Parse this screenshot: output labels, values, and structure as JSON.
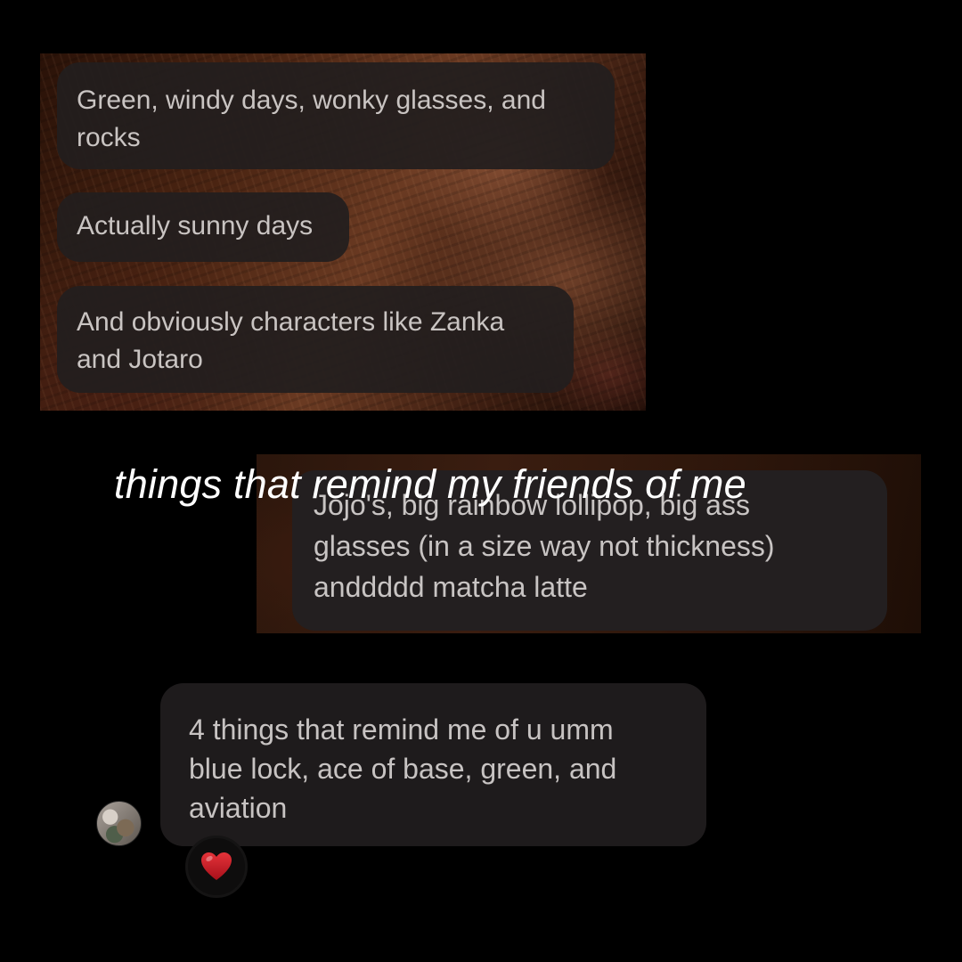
{
  "screenshot_top": {
    "messages": [
      {
        "text": "Green, windy days, wonky glasses, and\nrocks"
      },
      {
        "text": "Actually sunny days"
      },
      {
        "text": "And obviously characters like Zanka\nand Jotaro"
      }
    ]
  },
  "screenshot_middle": {
    "message_line1": "Jojo's, big rainbow lollipop, big ass",
    "message_line2": "glasses (in a size way not thickness)",
    "message_line3": "anddddd matcha latte"
  },
  "overlay": {
    "caption": "things that remind my friends of me"
  },
  "chat_bottom": {
    "message": "4 things that remind me of u umm\nblue lock, ace of base, green, and\naviation",
    "reaction": "❤️",
    "avatar_icon": "profile-picture"
  },
  "colors": {
    "background": "#000000",
    "bubble": "#231f20",
    "text": "#c8c4c3",
    "caption": "#ffffff",
    "heart": "#c0141c"
  }
}
